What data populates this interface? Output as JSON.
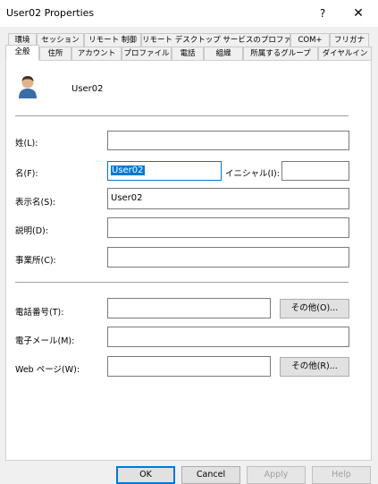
{
  "window": {
    "title": "User02 Properties",
    "help_label": "?",
    "close_label": "✕"
  },
  "tabs_row1": [
    "環境",
    "セッション",
    "リモート 制御",
    "リモート デスクトップ サービスのプロファイル",
    "COM+",
    "フリガナ"
  ],
  "tabs_row2": [
    "全般",
    "住所",
    "アカウント",
    "プロファイル",
    "電話",
    "組織",
    "所属するグループ",
    "ダイヤルイン"
  ],
  "user": {
    "name": "User02",
    "icon": "user-avatar-icon"
  },
  "form": {
    "last_name_label": "姓(L):",
    "last_name_value": "",
    "first_name_label": "名(F):",
    "first_name_value": "User02",
    "initials_label": "イニシャル(I):",
    "initials_value": "",
    "display_name_label": "表示名(S):",
    "display_name_value": "User02",
    "description_label": "説明(D):",
    "description_value": "",
    "office_label": "事業所(C):",
    "office_value": "",
    "phone_label": "電話番号(T):",
    "phone_value": "",
    "phone_other_button": "その他(O)...",
    "email_label": "電子メール(M):",
    "email_value": "",
    "web_label": "Web ページ(W):",
    "web_value": "",
    "web_other_button": "その他(R)..."
  },
  "buttons": {
    "ok": "OK",
    "cancel": "Cancel",
    "apply": "Apply",
    "help": "Help"
  },
  "colors": {
    "accent": "#0078d7",
    "panel": "#ffffff",
    "dialog": "#f0f0f0"
  }
}
